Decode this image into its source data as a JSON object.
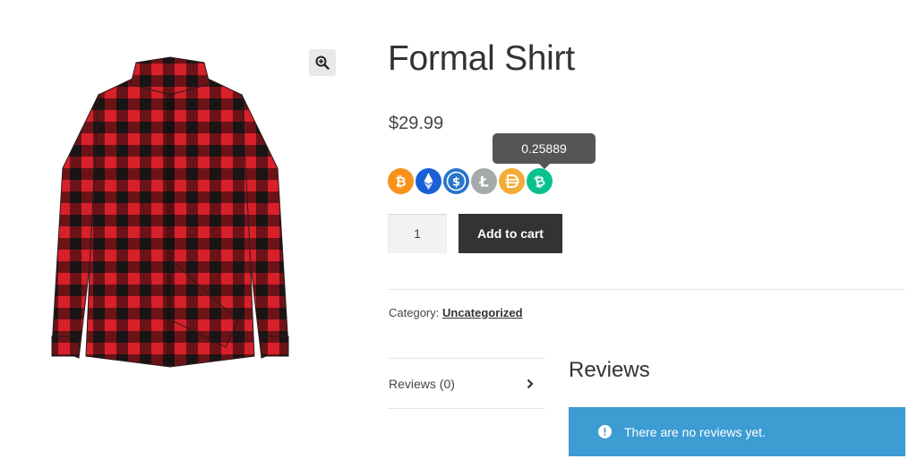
{
  "product": {
    "title": "Formal Shirt",
    "price": "$29.99",
    "image_alt": "Red and black plaid shirt"
  },
  "crypto": {
    "tooltip": "0.25889",
    "coins": [
      {
        "name": "bitcoin",
        "color": "#f7931a"
      },
      {
        "name": "ethereum",
        "color": "#1a5fd6"
      },
      {
        "name": "usd-coin",
        "color": "#2775ca"
      },
      {
        "name": "litecoin",
        "color": "#a6a9aa"
      },
      {
        "name": "dai",
        "color": "#f5ac37"
      },
      {
        "name": "bitcoin-cash",
        "color": "#0ac18e"
      }
    ]
  },
  "cart": {
    "quantity": "1",
    "button_label": "Add to cart"
  },
  "meta": {
    "category_label": "Category:",
    "category_value": "Uncategorized"
  },
  "tabs": [
    {
      "label": "Reviews (0)"
    }
  ],
  "reviews": {
    "heading": "Reviews",
    "notice": "There are no reviews yet."
  },
  "colors": {
    "notice_bg": "#3d9cd2",
    "button_bg": "#333333",
    "tooltip_bg": "#555555"
  }
}
